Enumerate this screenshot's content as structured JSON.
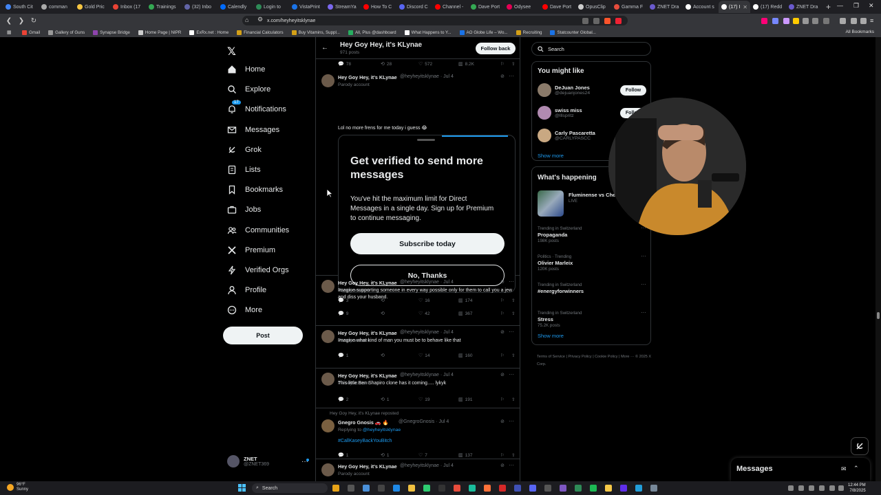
{
  "browser": {
    "tabs": [
      {
        "label": "South Cit",
        "color": "#4285f4"
      },
      {
        "label": "comman",
        "color": "#aaaaaa"
      },
      {
        "label": "Gold Pric",
        "color": "#f5c542"
      },
      {
        "label": "Inbox (17",
        "color": "#ea4335"
      },
      {
        "label": "Trainings",
        "color": "#34a853"
      },
      {
        "label": "(32) Inbo",
        "color": "#6264a7"
      },
      {
        "label": "Calendly",
        "color": "#006bff"
      },
      {
        "label": "Login to",
        "color": "#2e8b57"
      },
      {
        "label": "VistaPrint",
        "color": "#1a73e8"
      },
      {
        "label": "StreamYa",
        "color": "#7b68ee"
      },
      {
        "label": "How To C",
        "color": "#ff0000"
      },
      {
        "label": "Discord C",
        "color": "#5865f2"
      },
      {
        "label": "Channel -",
        "color": "#ff0000"
      },
      {
        "label": "Dave Port",
        "color": "#34a853"
      },
      {
        "label": "Odysee",
        "color": "#e50054"
      },
      {
        "label": "Dave Port",
        "color": "#ff0000"
      },
      {
        "label": "OpusClip",
        "color": "#cccccc"
      },
      {
        "label": "Gamma F",
        "color": "#e74c3c"
      },
      {
        "label": "ZNET Dra",
        "color": "#6a5acd"
      },
      {
        "label": "Account s",
        "color": "#ffffff"
      },
      {
        "label": "(17) I",
        "color": "#ffffff",
        "active": true
      },
      {
        "label": "(17) Redd",
        "color": "#ffffff"
      },
      {
        "label": "ZNET Dra",
        "color": "#6a5acd"
      }
    ],
    "new_tab": "+",
    "url": "x.com/heyheyitsklynae",
    "bookmarks": [
      {
        "label": "Gmail",
        "color": "#ea4335"
      },
      {
        "label": "Gallery of Guns",
        "color": "#999999"
      },
      {
        "label": "Synapse Bridge",
        "color": "#8e44ad"
      },
      {
        "label": "Home Page | NIPR",
        "color": "#cccccc"
      },
      {
        "label": "ExRx.net : Home",
        "color": "#ffffff"
      },
      {
        "label": "Financial Calculators",
        "color": "#d4a017"
      },
      {
        "label": "Buy Vitamins, Suppl...",
        "color": "#d4a017"
      },
      {
        "label": "All, Plus @dashboard",
        "color": "#27ae60"
      },
      {
        "label": "What Happens to Y...",
        "color": "#ffffff"
      },
      {
        "label": "AO Globe Life – Wo...",
        "color": "#1a73e8"
      },
      {
        "label": "Recruiting",
        "color": "#d4a017"
      },
      {
        "label": "Statcounter Global...",
        "color": "#1a73e8"
      }
    ],
    "all_bookmarks": "All Bookmarks"
  },
  "nav": {
    "items": [
      "Home",
      "Explore",
      "Notifications",
      "Messages",
      "Grok",
      "Lists",
      "Bookmarks",
      "Jobs",
      "Communities",
      "Premium",
      "Verified Orgs",
      "Profile",
      "More"
    ],
    "notif_badge": "17",
    "post_label": "Post",
    "account_name": "ZNET",
    "account_handle": "@ZNET369"
  },
  "profile_header": {
    "title": "Hey Goy Hey, it's KLynae",
    "posts": "971 posts",
    "follow_back": "Follow back"
  },
  "top_actions": {
    "replies": "78",
    "reposts": "28",
    "likes": "572",
    "views": "8.2K"
  },
  "tweets": [
    {
      "name": "Hey Goy Hey, it's KLynae",
      "meta": "@heyheyitsklynae · Jul 4",
      "badge": "Parody account",
      "text": "Lol no more frens for me today i guess 😂",
      "replies": "3",
      "reposts": "",
      "likes": "16",
      "views": "174"
    },
    {
      "name": "Hey Goy Hey, it's KLynae",
      "meta": "@heyheyitsklynae · Jul 4",
      "badge": "Parody account",
      "text": "Imagine supporting someone in every way possible only for them to call you a jew and diss your husband.",
      "replies": "9",
      "reposts": "",
      "likes": "42",
      "views": "367"
    },
    {
      "name": "Hey Goy Hey, it's KLynae",
      "meta": "@heyheyitsklynae · Jul 4",
      "badge": "Parody account",
      "text": "Imagine what kind of man you must be to behave like that",
      "replies": "1",
      "reposts": "",
      "likes": "14",
      "views": "160"
    },
    {
      "name": "Hey Goy Hey, it's KLynae",
      "meta": "@heyheyitsklynae · Jul 4",
      "badge": "Parody account",
      "text": "This little Ben Shapiro clone has it coming..... lykyk",
      "replies": "2",
      "reposts": "1",
      "likes": "19",
      "views": "191"
    },
    {
      "repost_label": "Hey Goy Hey, it's KLynae reposted",
      "name": "Gnegro Gnosis 🚗 🔥",
      "meta": "@GnegroGnosis · Jul 4",
      "reply_to_prefix": "Replying to",
      "reply_to": "@heyheyitsklynae",
      "text": "#CallKaseyBackYouBitch",
      "replies": "1",
      "reposts": "1",
      "likes": "7",
      "views": "137"
    },
    {
      "name": "Hey Goy Hey, it's KLynae",
      "meta": "@heyheyitsklynae · Jul 4",
      "badge": "Parody account"
    }
  ],
  "modal": {
    "title": "Get verified to send more messages",
    "body": "You've hit the maximum limit for Direct Messages in a single day. Sign up for Premium to continue messaging.",
    "subscribe": "Subscribe today",
    "no_thanks": "No, Thanks"
  },
  "sidebar": {
    "search_placeholder": "Search",
    "might_like_title": "You might like",
    "suggestions": [
      {
        "name": "DeJuan Jones",
        "handle": "@dejuanjones24",
        "follow": "Follow",
        "color": "#8a7a6a"
      },
      {
        "name": "swiss miss",
        "handle": "@lllspritz",
        "follow": "Follow",
        "color": "#b08ab0"
      },
      {
        "name": "Carly Pascaretta",
        "handle": "@CARLYPASCC",
        "follow": "",
        "color": "#c9a882"
      }
    ],
    "show_more": "Show more",
    "happening_title": "What's happening",
    "live_event": {
      "title": "Fluminense vs Che",
      "status": "LIVE"
    },
    "trends": [
      {
        "context": "Trending in Switzerland",
        "title": "Propaganda",
        "posts": "198K posts"
      },
      {
        "context": "Politics · Trending",
        "title": "Olivier Marleix",
        "posts": "120K posts"
      },
      {
        "context": "Trending in Switzerland",
        "title": "#energyforwinners",
        "posts": ""
      },
      {
        "context": "Trending in Switzerland",
        "title": "Stress",
        "posts": "75.2K posts"
      }
    ],
    "show_more_2": "Show more",
    "footer": "Terms of Service  |  Privacy Policy  |  Cookie Policy  |  More ···  © 2025 X Corp."
  },
  "messages_drawer": {
    "title": "Messages"
  },
  "taskbar": {
    "temp": "96°F",
    "weather": "Sunny",
    "search": "Search",
    "time": "12:44 PM",
    "date": "7/8/2025"
  }
}
